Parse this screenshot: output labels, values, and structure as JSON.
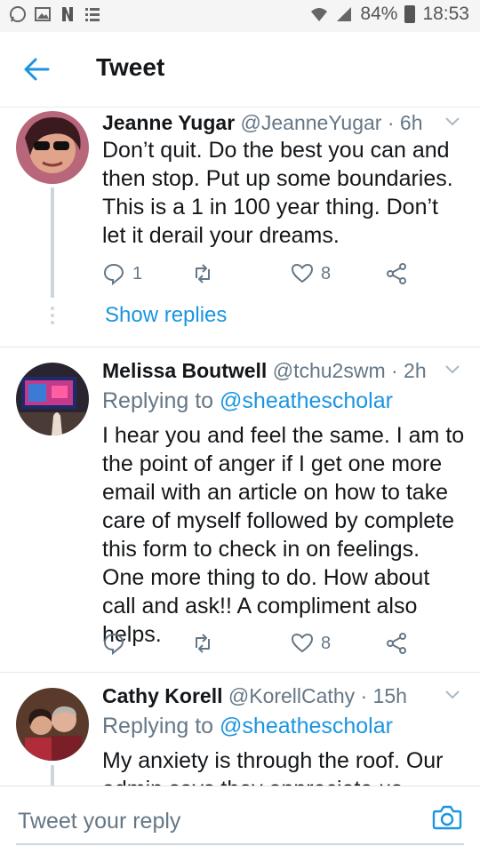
{
  "status_bar": {
    "battery": "84%",
    "time": "18:53",
    "left_icons": [
      "whatsapp-icon",
      "image-icon",
      "netflix-icon",
      "notes-icon"
    ],
    "right_icons": [
      "wifi-icon",
      "signal-icon",
      "battery-icon"
    ]
  },
  "header": {
    "title": "Tweet",
    "back_icon": "back-arrow-icon",
    "accent": "#1b95e0"
  },
  "tweets": [
    {
      "name": "Jeanne Yugar",
      "handle": "@JeanneYugar",
      "time": "· 6h",
      "replying_label": "",
      "replying_to": "",
      "text": "Don’t quit. Do the best you can and then stop. Put up some boundaries. This is a 1 in 100 year thing. Don’t let it derail your dreams.",
      "replies": "1",
      "retweets": "",
      "likes": "8",
      "show_replies": "Show replies"
    },
    {
      "name": "Melissa Boutwell",
      "handle": "@tchu2swm",
      "time": "· 2h",
      "replying_label": "Replying to",
      "replying_to": "@sheathescholar",
      "text": "I hear you and feel the same. I am to the point of anger if I get one more email with an article on how to take care of myself followed by complete this form to check in on feelings. One more thing to do. How about call and ask!! A compliment also helps.",
      "replies": "",
      "retweets": "",
      "likes": "8"
    },
    {
      "name": "Cathy Korell",
      "handle": "@KorellCathy",
      "time": "· 15h",
      "replying_label": "Replying to",
      "replying_to": "@sheathescholar",
      "text": "My anxiety is through the roof. Our admin says they appreciate us"
    }
  ],
  "composer": {
    "placeholder": "Tweet your reply",
    "camera_icon": "camera-icon"
  }
}
